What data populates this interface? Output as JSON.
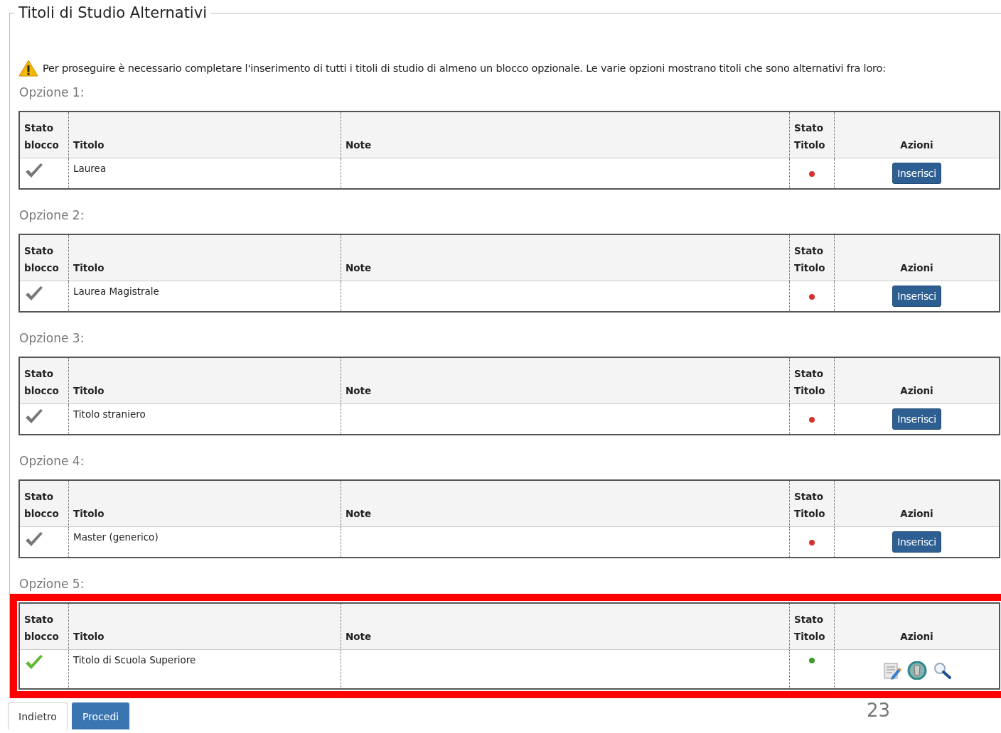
{
  "section": {
    "title": "Titoli di Studio Alternativi",
    "warning": "Per proseguire è necessario completare l'inserimento di tutti i titoli di studio di almeno un blocco opzionale. Le varie opzioni mostrano titoli che sono alternativi fra loro:"
  },
  "options": [
    {
      "label": "Opzione 1:",
      "highlighted": false,
      "columns": [
        "Stato blocco",
        "Titolo",
        "Note",
        "Stato Titolo",
        "Azioni"
      ],
      "row": {
        "block_complete": false,
        "title": "Laurea",
        "title_complete": false,
        "actions": {
          "kind": "button",
          "label": "Inserisci"
        }
      }
    },
    {
      "label": "Opzione 2:",
      "highlighted": false,
      "columns": [
        "Stato blocco",
        "Titolo",
        "Note",
        "Stato Titolo",
        "Azioni"
      ],
      "row": {
        "block_complete": false,
        "title": "Laurea Magistrale",
        "title_complete": false,
        "actions": {
          "kind": "button",
          "label": "Inserisci"
        }
      }
    },
    {
      "label": "Opzione 3:",
      "highlighted": false,
      "columns": [
        "Stato blocco",
        "Titolo",
        "Note",
        "Stato Titolo",
        "Azioni"
      ],
      "row": {
        "block_complete": false,
        "title": "Titolo straniero",
        "title_complete": false,
        "actions": {
          "kind": "button",
          "label": "Inserisci"
        }
      }
    },
    {
      "label": "Opzione 4:",
      "highlighted": false,
      "columns": [
        "Stato blocco",
        "Titolo",
        "Note",
        "Stato Titolo",
        "Azioni"
      ],
      "row": {
        "block_complete": false,
        "title": "Master (generico)",
        "title_complete": false,
        "actions": {
          "kind": "button",
          "label": "Inserisci"
        }
      }
    },
    {
      "label": "Opzione 5:",
      "highlighted": true,
      "columns": [
        "Stato blocco",
        "Titolo",
        "Note",
        "Stato Titolo",
        "Azioni"
      ],
      "row": {
        "block_complete": true,
        "title": "Titolo di Scuola Superiore",
        "title_complete": true,
        "actions": {
          "kind": "icons"
        }
      }
    }
  ],
  "buttons": [
    {
      "label": "Indietro",
      "primary": false
    },
    {
      "label": "Procedi",
      "primary": true
    }
  ],
  "page_number": "23"
}
